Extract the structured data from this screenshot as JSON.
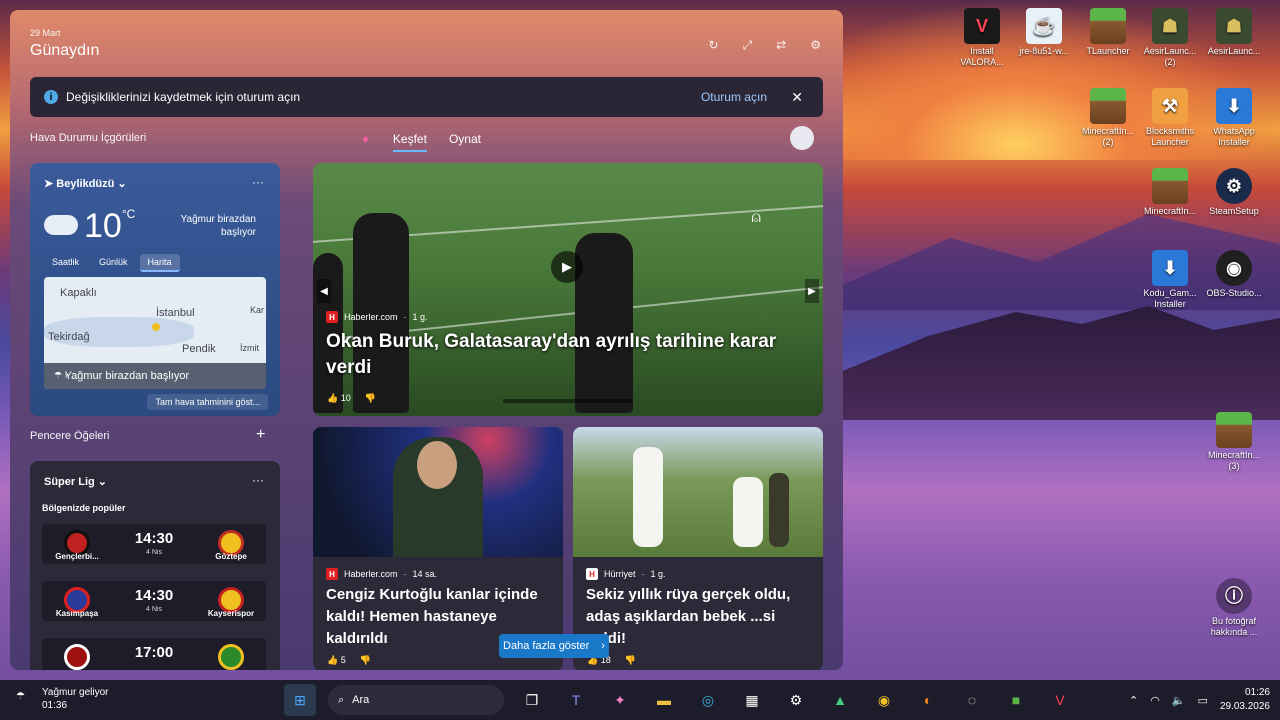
{
  "widgets": {
    "date": "29 Mart",
    "greeting": "Günaydın",
    "banner": {
      "text": "Değişikliklerinizi kaydetmek için oturum açın",
      "link": "Oturum açın"
    },
    "weather_section": "Hava Durumu İçgörüleri",
    "weather": {
      "location": "Beylikdüzü",
      "temp": "10",
      "unit": "°C",
      "desc_line1": "Yağmur birazdan",
      "desc_line2": "başlıyor",
      "tabs": [
        "Saatlik",
        "Günlük",
        "Harita"
      ],
      "map_labels": [
        "Kapaklı",
        "İstanbul",
        "Tekirdağ",
        "Pendik",
        "İzmit",
        "Kar"
      ],
      "map_status": "Yağmur birazdan başlıyor",
      "more": "Tam hava tahminini göst..."
    },
    "window_section": "Pencere Öğeleri",
    "league": {
      "title": "Süper Lig",
      "subtitle": "Bölgenizde popüler",
      "matches": [
        {
          "home": "Gençlerbi...",
          "away": "Göztepe",
          "time": "14:30",
          "date": "4 Nis"
        },
        {
          "home": "Kasımpaşa",
          "away": "Kayserispor",
          "time": "14:30",
          "date": "4 Nis"
        },
        {
          "home": "",
          "away": "",
          "time": "17:00",
          "date": ""
        }
      ]
    },
    "feed_tabs": [
      "Keşfet",
      "Oynat"
    ],
    "hero": {
      "source": "Haberler.com",
      "age": "1 g.",
      "title": "Okan Buruk, Galatasaray'dan ayrılış tarihine karar verdi",
      "likes": "10"
    },
    "card1": {
      "source": "Haberler.com",
      "age": "14 sa.",
      "title": "Cengiz Kurtoğlu kanlar içinde kaldı! Hemen hastaneye kaldırıldı",
      "likes": "5"
    },
    "card2": {
      "source": "Hürriyet",
      "age": "1 g.",
      "title": "Sekiz yıllık rüya gerçek oldu, adaş aşıklardan bebek ...si geldi!",
      "likes": "18"
    },
    "more_button": "Daha fazla göster"
  },
  "desktop": [
    {
      "label": "Install VALORA...",
      "name": "valorant-icon"
    },
    {
      "label": "jre-8u51-w...",
      "name": "java-icon"
    },
    {
      "label": "TLauncher",
      "name": "minecraft-icon"
    },
    {
      "label": "AesirLaunc... (2)",
      "name": "aesir-icon"
    },
    {
      "label": "AesirLaunc...",
      "name": "aesir-icon"
    },
    {
      "label": "MinecraftIn... (2)",
      "name": "minecraft-icon"
    },
    {
      "label": "Blocksmiths Launcher",
      "name": "hammer-icon"
    },
    {
      "label": "WhatsApp Installer",
      "name": "download-icon"
    },
    {
      "label": "MinecraftIn...",
      "name": "minecraft-icon"
    },
    {
      "label": "SteamSetup",
      "name": "steam-icon"
    },
    {
      "label": "Kodu_Gam... Installer",
      "name": "download-icon"
    },
    {
      "label": "OBS-Studio...",
      "name": "obs-icon"
    },
    {
      "label": "MinecraftIn... (3)",
      "name": "minecraft-icon"
    },
    {
      "label": "Bu fotoğraf hakkında ...",
      "name": "info-icon"
    }
  ],
  "taskbar": {
    "weather": "Yağmur geliyor",
    "weather_time": "01:36",
    "search": "Ara",
    "time": "01:26",
    "date": "29.03.2026"
  }
}
